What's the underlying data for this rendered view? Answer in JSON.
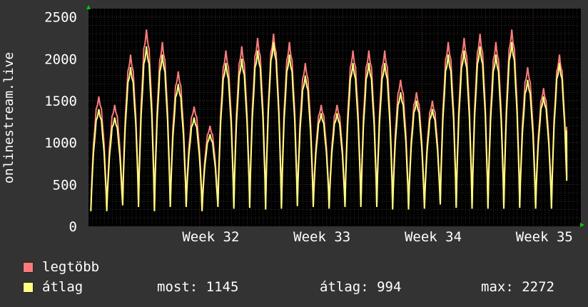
{
  "chart_data": {
    "type": "line",
    "ylabel": "onlinestream.live",
    "y_ticks": [
      "0",
      "500",
      "1000",
      "1500",
      "2000",
      "2500"
    ],
    "ylim": [
      0,
      2600
    ],
    "x_ticks": [
      {
        "label": "Week 32",
        "day": 7
      },
      {
        "label": "Week 33",
        "day": 14
      },
      {
        "label": "Week 34",
        "day": 21
      },
      {
        "label": "Week 35",
        "day": 28
      }
    ],
    "xlim_days": [
      0,
      31
    ],
    "grid": true,
    "series": [
      {
        "name": "legtöbb",
        "color": "#ff7b7b",
        "daily_peaks": [
          1550,
          1450,
          2050,
          2350,
          2200,
          1850,
          1430,
          1200,
          2100,
          2150,
          2250,
          2300,
          2200,
          1950,
          1450,
          1450,
          2100,
          2100,
          2100,
          1750,
          1600,
          1500,
          2200,
          2250,
          2300,
          2200,
          2350,
          1900,
          1650,
          2050
        ],
        "daily_lows": [
          200,
          200,
          270,
          250,
          200,
          250,
          250,
          200,
          250,
          230,
          240,
          220,
          230,
          260,
          250,
          230,
          250,
          250,
          250,
          220,
          220,
          230,
          280,
          240,
          230,
          230,
          230,
          240,
          230,
          230
        ]
      },
      {
        "name": "átlag",
        "color": "#ffff80",
        "daily_peaks": [
          1400,
          1300,
          1900,
          2150,
          2050,
          1700,
          1300,
          1100,
          1950,
          2000,
          2100,
          2200,
          2050,
          1800,
          1350,
          1350,
          1950,
          1950,
          1950,
          1600,
          1500,
          1400,
          2050,
          2100,
          2150,
          2050,
          2200,
          1750,
          1550,
          1950
        ],
        "daily_lows": [
          180,
          180,
          250,
          230,
          180,
          230,
          230,
          180,
          230,
          210,
          220,
          200,
          210,
          240,
          230,
          210,
          230,
          230,
          230,
          200,
          200,
          210,
          260,
          220,
          210,
          210,
          210,
          220,
          210,
          210
        ],
        "last_value": 1145
      }
    ]
  },
  "legend": {
    "max_label": "legtöbb",
    "avg_label": "átlag"
  },
  "stats": {
    "now": "most: 1145",
    "avg": "átlag: 994",
    "max": "max: 2272"
  },
  "colors": {
    "background": "#333333",
    "plot_background": "#000000",
    "grid_major": "#4a3030",
    "grid_minor": "#2a2a2a",
    "text": "#ffffff",
    "arrow": "#00cc00"
  }
}
